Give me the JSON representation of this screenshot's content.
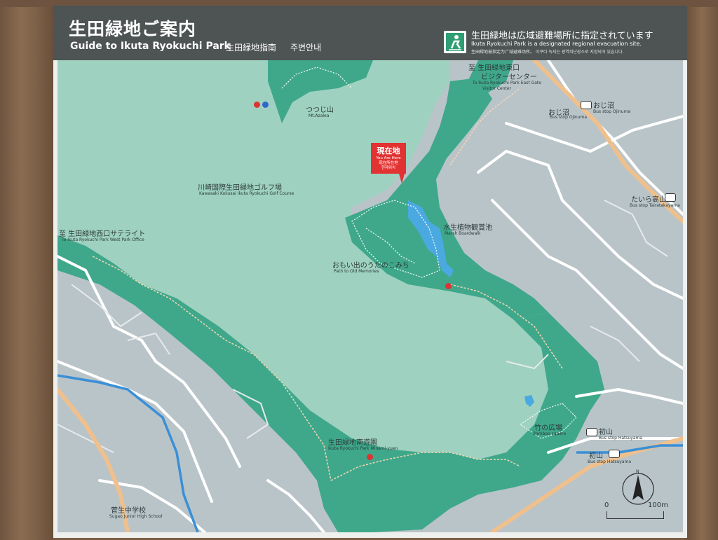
{
  "header": {
    "title_jp": "生田緑地ご案内",
    "title_en": "Guide to Ikuta Ryokuchi Park",
    "title_cn": "生田緑地指南",
    "title_kr": "주변안내",
    "evac_jp": "生田緑地は広域避難場所に指定されています",
    "evac_en": "Ikuta Ryokuchi Park is a designated regional evacuation site.",
    "evac_sub": "生田緑地被指定为广域避难场所。 이쿠타 녹지는 광역피난장소로 지정되어 있습니다.",
    "evac_icon": "evacuation-site-icon",
    "evac_color": "#2f9e74"
  },
  "colors": {
    "park_light": "#9ed1bf",
    "park_dark": "#3fa88a",
    "urban": "#b9c4c9",
    "road": "#ffffff",
    "river": "#3a8fd6",
    "trail": "#e8a060",
    "here": "#e23232"
  },
  "you_are_here": {
    "jp": "現在地",
    "en": "You Are Here",
    "cn": "现在所在地",
    "kr": "현재위치"
  },
  "labels": {
    "tsutsuji_jp": "つつじ山",
    "tsutsuji_en": "Mt.Azalea",
    "golf_jp": "川崎国際生田緑地ゴルフ場",
    "golf_en": "Kawasaki Kokusai Ikuta Ryokuchi Golf Course",
    "west_jp": "至 生田緑地西口サテライト",
    "west_en": "To Ikuta Ryokuchi Park West Park Office",
    "east_jp1": "至 生田緑地東口",
    "east_jp2": "ビジターセンター",
    "east_en1": "To Ikuta Ryokuchi Park East Gate",
    "east_en2": "Visitor Center",
    "marsh_jp": "水生植物観賞池",
    "marsh_en": "Marsh Boardwalk",
    "memories_jp": "おもい出のうたのこみち",
    "memories_en": "Path to Old Memories",
    "minami_jp": "生田緑地南遊園",
    "minami_en": "Ikuta Ryokuchi Park Minami-yuen",
    "bamboo_jp": "竹の広場",
    "bamboo_en": "Bamboo square",
    "ojizo_jp": "おじ沼",
    "ojizo_en": "Bus stop Ojinuma",
    "taira_jp": "たいら高山",
    "taira_en": "Bus stop Tairatakayama",
    "hatsu_jp": "初山",
    "hatsu_en": "Bus stop Hatsuyama",
    "school_jp": "菅生中学校",
    "school_en": "Sugao Junior High School",
    "ojizo_stop": "おじ沼",
    "ojizo_stop_en": "Bus stop Ojinuma"
  },
  "scale": {
    "zero": "0",
    "hundred": "100m",
    "north": "N"
  }
}
